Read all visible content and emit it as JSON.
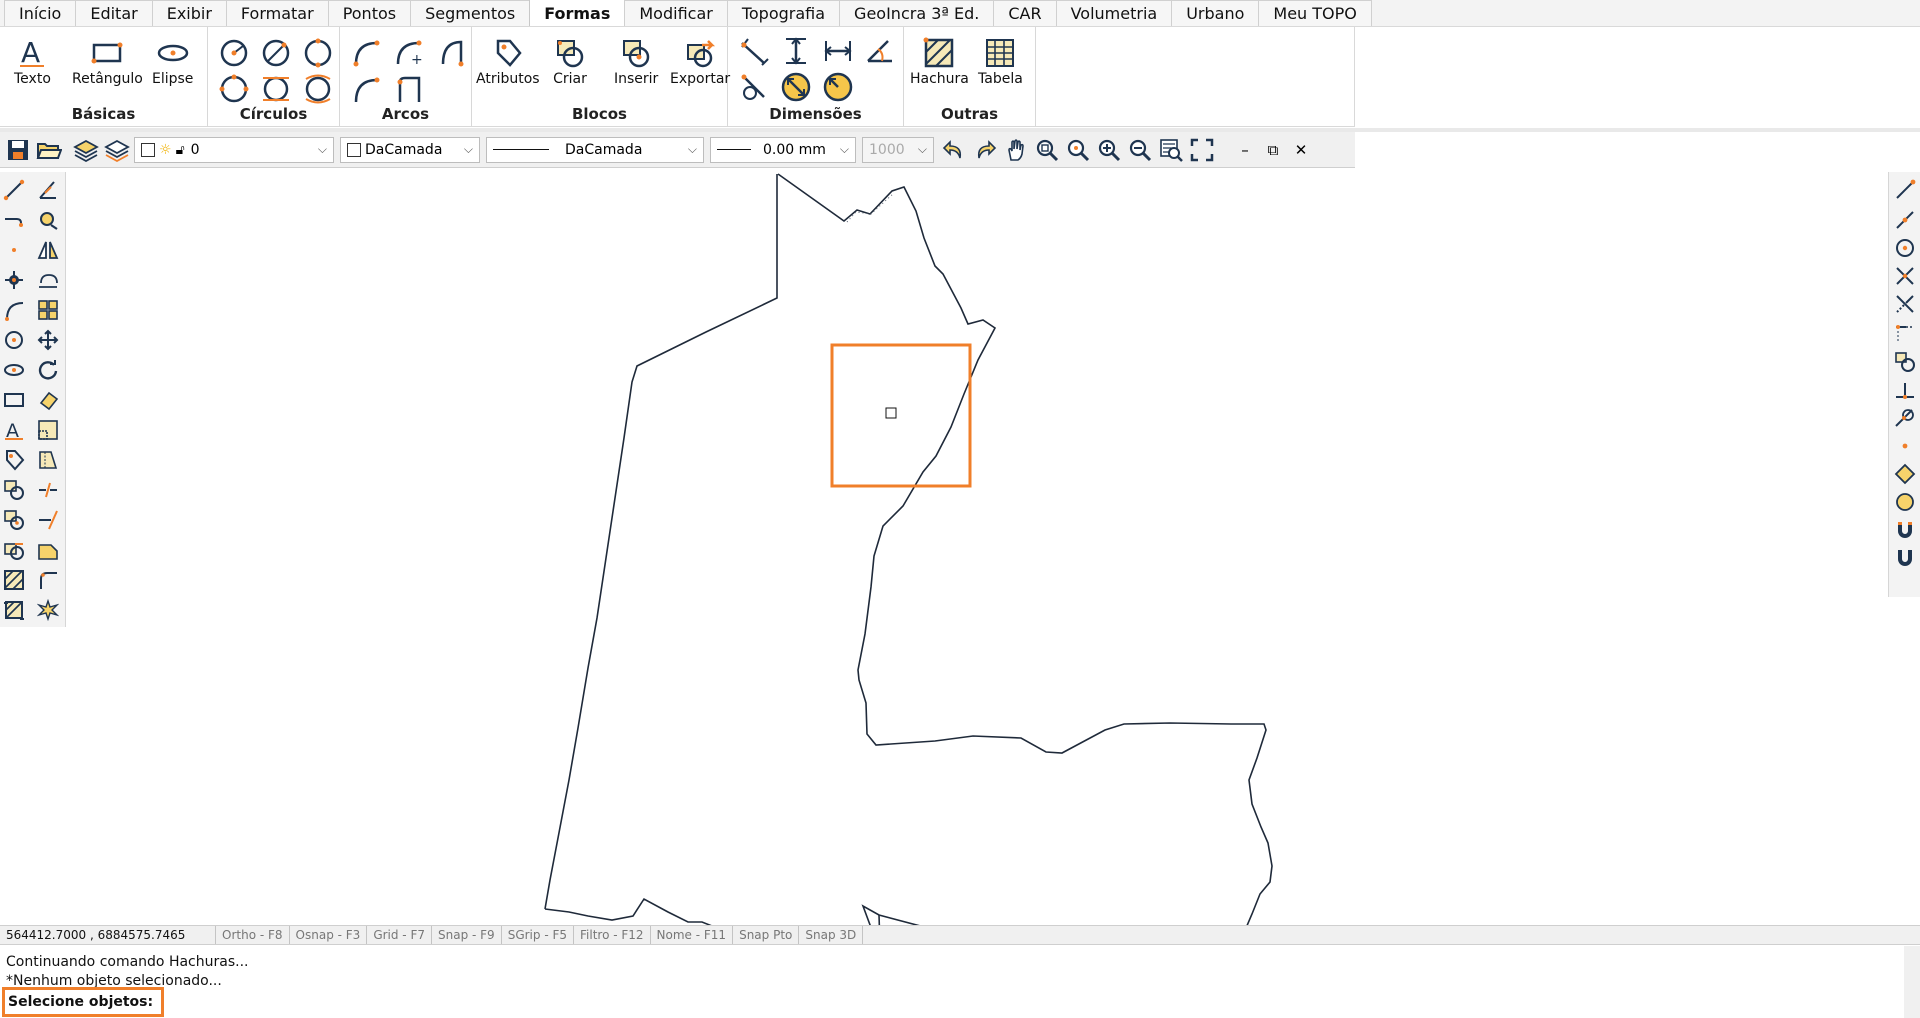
{
  "tabs": [
    "Início",
    "Editar",
    "Exibir",
    "Formatar",
    "Pontos",
    "Segmentos",
    "Formas",
    "Modificar",
    "Topografia",
    "GeoIncra 3ª Ed.",
    "CAR",
    "Volumetria",
    "Urbano",
    "Meu TOPO"
  ],
  "active_tab": "Formas",
  "ribbon": {
    "basicas": {
      "label": "Básicas",
      "texto": "Texto",
      "retangulo": "Retângulo",
      "elipse": "Elipse"
    },
    "circulos": {
      "label": "Círculos"
    },
    "arcos": {
      "label": "Arcos"
    },
    "blocos": {
      "label": "Blocos",
      "atributos": "Atributos",
      "criar": "Criar",
      "inserir": "Inserir",
      "exportar": "Exportar"
    },
    "dimensoes": {
      "label": "Dimensões"
    },
    "outras": {
      "label": "Outras",
      "hachura": "Hachura",
      "tabela": "Tabela"
    }
  },
  "toolbar": {
    "layer": "0",
    "color": "DaCamada",
    "linetype": "DaCamada",
    "lineweight": "0.00 mm",
    "scale": "1000"
  },
  "status": {
    "coords": "564412.7000 , 6884575.7465",
    "items": [
      "Ortho - F8",
      "Osnap - F3",
      "Grid - F7",
      "Snap - F9",
      "SGrip - F5",
      "Filtro - F12",
      "Nome - F11",
      "Snap Pto",
      "Snap 3D"
    ]
  },
  "command": {
    "line1": "Continuando comando Hachuras...",
    "line2": "*Nenhum objeto selecionado...",
    "prompt": "Selecione objetos:"
  },
  "colors": {
    "accent": "#f07f2a",
    "icon": "#1f3550",
    "highlight": "#f07f2a"
  }
}
